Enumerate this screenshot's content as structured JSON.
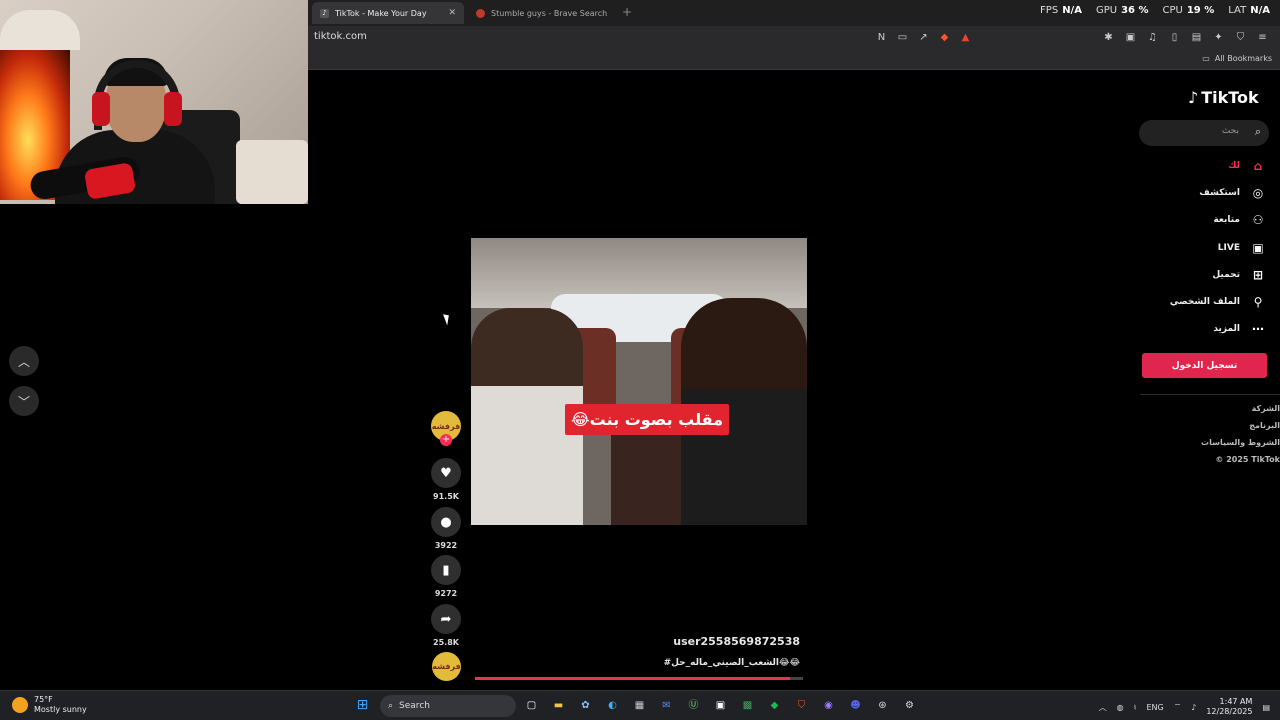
{
  "browser": {
    "tabs": [
      {
        "label": "TikTok - Make Your Day",
        "favicon": "tiktok-icon",
        "active": true
      },
      {
        "label": "Stumble guys - Brave Search",
        "favicon": "brave-search-icon",
        "active": false
      }
    ],
    "new_tab": "+",
    "url": "tiktok.com",
    "bookmarks_label": "All Bookmarks",
    "stats": [
      {
        "label": "FPS",
        "value": "N/A"
      },
      {
        "label": "GPU",
        "value": "36 %"
      },
      {
        "label": "CPU",
        "value": "19 %"
      },
      {
        "label": "LAT",
        "value": "N/A"
      }
    ]
  },
  "video": {
    "caption": "مقلب بصوت بنت😂",
    "username": "user2558569872538",
    "hashtags": "#الشعب_الصيني_ماله_حل😂😂",
    "progress": 0.96,
    "creator_avatar_text": "فرفشه",
    "music_disc_text": "فرفشه"
  },
  "actions": {
    "likes": "91.5K",
    "comments": "3922",
    "bookmarks": "9272",
    "shares": "25.8K"
  },
  "sidebar": {
    "logo": "TikTok",
    "search_placeholder": "بحث",
    "nav": [
      {
        "label": "لك",
        "icon": "home-icon",
        "active": true
      },
      {
        "label": "استكشف",
        "icon": "compass-icon",
        "active": false
      },
      {
        "label": "متابعة",
        "icon": "user-plus-icon",
        "active": false
      },
      {
        "label": "LIVE",
        "icon": "live-icon",
        "active": false
      },
      {
        "label": "تحميل",
        "icon": "upload-icon",
        "active": false
      },
      {
        "label": "الملف الشخصي",
        "icon": "profile-icon",
        "active": false
      },
      {
        "label": "المزيد",
        "icon": "more-icon",
        "active": false
      }
    ],
    "login_button": "تسجيل الدخول",
    "footer": [
      "الشركة",
      "البرنامج",
      "الشروط والسياسات",
      "© 2025 TikTok"
    ]
  },
  "taskbar": {
    "weather_temp": "75°F",
    "weather_desc": "Mostly sunny",
    "search_label": "Search",
    "language": "ENG",
    "time": "1:47 AM",
    "date": "12/28/2025"
  },
  "colors": {
    "accent": "#fe2c55",
    "login": "#e0264e",
    "caption_bg": "#e0252f"
  }
}
